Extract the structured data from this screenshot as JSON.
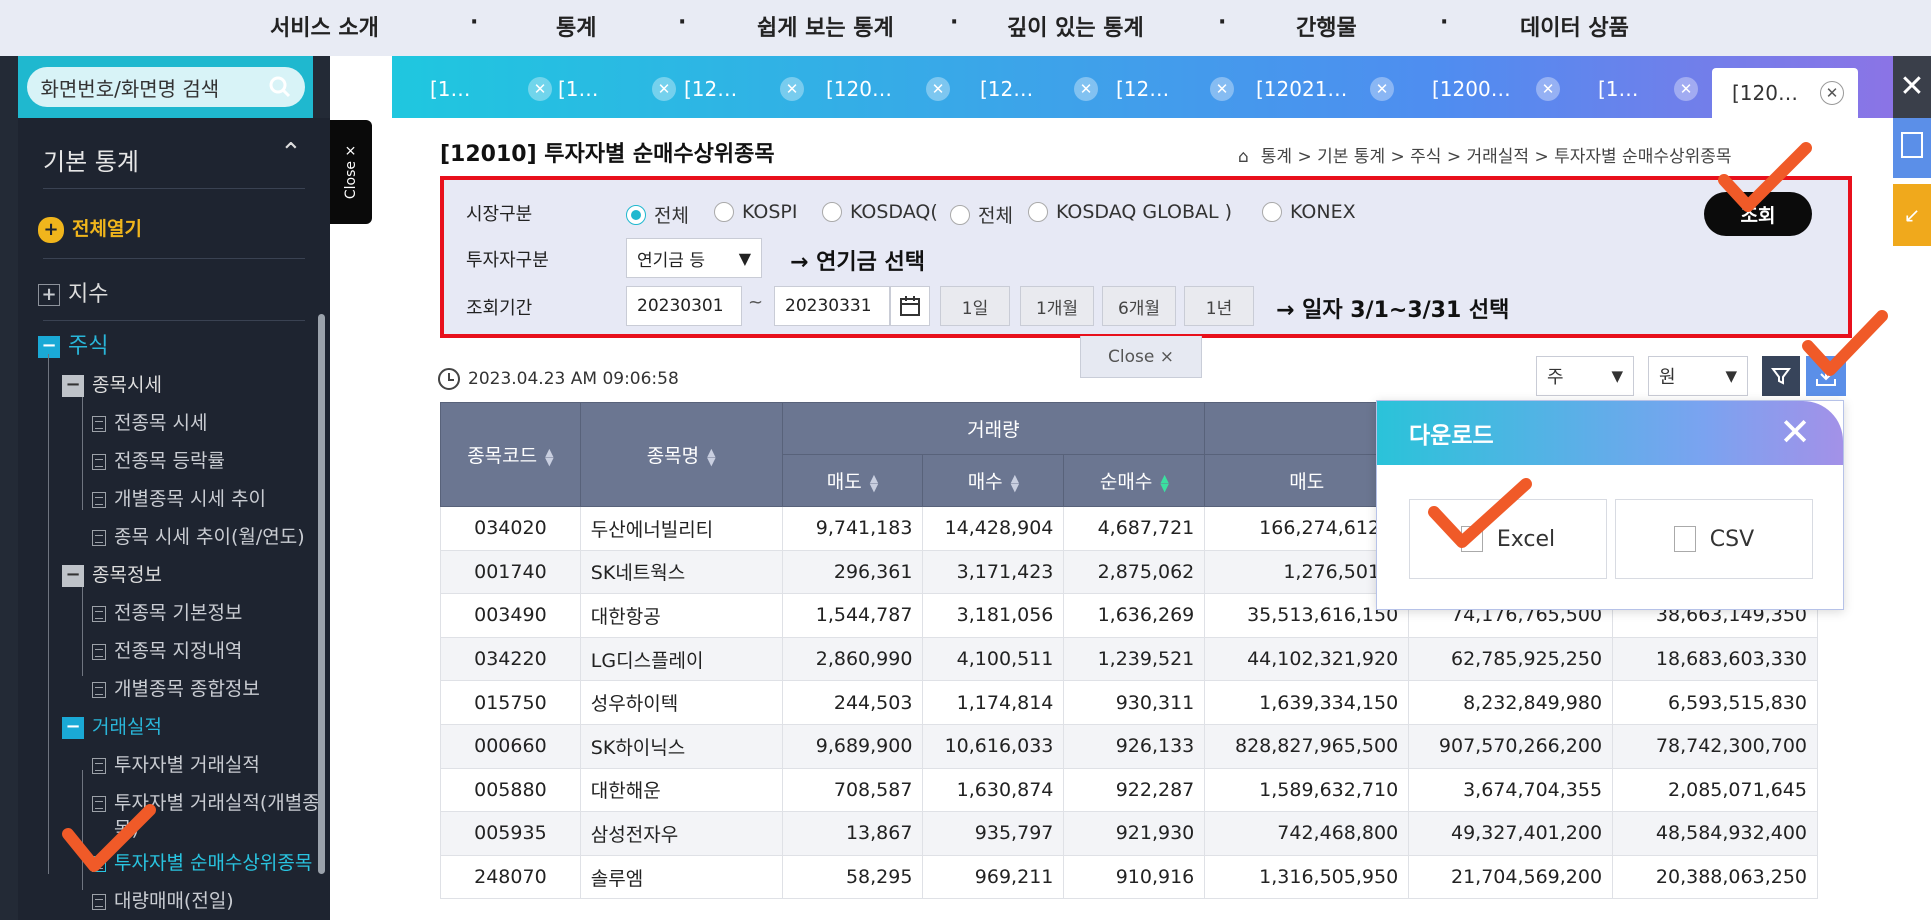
{
  "topnav": {
    "items": [
      "서비스 소개",
      "통계",
      "쉽게 보는 통계",
      "깊이 있는 통계",
      "간행물",
      "데이터 상품"
    ],
    "separator": "·"
  },
  "sidebar": {
    "search_placeholder": "화면번호/화면명 검색",
    "section_title": "기본 통계",
    "expand_all": "전체열기",
    "items": {
      "index": "지수",
      "stock": "주식",
      "price_group": "종목시세",
      "price_all": "전종목 시세",
      "price_change": "전종목 등락률",
      "price_trend": "개별종목 시세 추이",
      "price_trend_monthly": "종목 시세 추이(월/연도)",
      "info_group": "종목정보",
      "info_basic": "전종목 기본정보",
      "info_designation": "전종목 지정내역",
      "info_summary": "개별종목 종합정보",
      "trade_group": "거래실적",
      "trade_investor": "투자자별 거래실적",
      "trade_investor_indiv": "투자자별 거래실적(개별종",
      "trade_investor_indiv2": "목)",
      "trade_net_top": "투자자별 순매수상위종목",
      "block_trade": "대량매매(전일)"
    },
    "close_label": "Close ×"
  },
  "tabs": [
    {
      "label": "[1…"
    },
    {
      "label": "[1…"
    },
    {
      "label": "[12…"
    },
    {
      "label": "[120…"
    },
    {
      "label": "[12…"
    },
    {
      "label": "[12…"
    },
    {
      "label": "[12021…"
    },
    {
      "label": "[1200…"
    },
    {
      "label": "[1…"
    },
    {
      "label": "[120…"
    }
  ],
  "page": {
    "title": "[12010] 투자자별 순매수상위종목",
    "breadcrumb": "통계  >  기본 통계  >  주식  >  거래실적  >  투자자별 순매수상위종목"
  },
  "filters": {
    "market_label": "시장구분",
    "market_options": [
      "전체",
      "KOSPI",
      "KOSDAQ(",
      "전체",
      "KOSDAQ GLOBAL )",
      "KONEX"
    ],
    "market_selected": 0,
    "investor_label": "투자자구분",
    "investor_value": "연기금 등",
    "investor_note": "→ 연기금 선택",
    "period_label": "조회기간",
    "date_from": "20230301",
    "date_sep": "~",
    "date_to": "20230331",
    "period_buttons": [
      "1일",
      "1개월",
      "6개월",
      "1년"
    ],
    "period_note": "→ 일자 3/1~3/31 선택",
    "search_button": "조회"
  },
  "close_chip": "Close  ×",
  "timestamp": "2023.04.23 AM 09:06:58",
  "unit_selects": {
    "share_unit": "주",
    "money_unit": "원"
  },
  "table": {
    "headers": {
      "code": "종목코드",
      "name": "종목명",
      "volume": "거래량",
      "sell": "매도",
      "buy": "매수",
      "net": "순매수",
      "sell2": "매도"
    },
    "rows": [
      [
        "034020",
        "두산에너빌리티",
        "9,741,183",
        "14,428,904",
        "4,687,721",
        "166,274,612,5",
        "",
        ""
      ],
      [
        "001740",
        "SK네트웍스",
        "296,361",
        "3,171,423",
        "2,875,062",
        "1,276,501,5",
        "",
        ""
      ],
      [
        "003490",
        "대한항공",
        "1,544,787",
        "3,181,056",
        "1,636,269",
        "35,513,616,150",
        "74,176,765,500",
        "38,663,149,350"
      ],
      [
        "034220",
        "LG디스플레이",
        "2,860,990",
        "4,100,511",
        "1,239,521",
        "44,102,321,920",
        "62,785,925,250",
        "18,683,603,330"
      ],
      [
        "015750",
        "성우하이텍",
        "244,503",
        "1,174,814",
        "930,311",
        "1,639,334,150",
        "8,232,849,980",
        "6,593,515,830"
      ],
      [
        "000660",
        "SK하이닉스",
        "9,689,900",
        "10,616,033",
        "926,133",
        "828,827,965,500",
        "907,570,266,200",
        "78,742,300,700"
      ],
      [
        "005880",
        "대한해운",
        "708,587",
        "1,630,874",
        "922,287",
        "1,589,632,710",
        "3,674,704,355",
        "2,085,071,645"
      ],
      [
        "005935",
        "삼성전자우",
        "13,867",
        "935,797",
        "921,930",
        "742,468,800",
        "49,327,401,200",
        "48,584,932,400"
      ],
      [
        "248070",
        "솔루엠",
        "58,295",
        "969,211",
        "910,916",
        "1,316,505,950",
        "21,704,569,200",
        "20,388,063,250"
      ]
    ]
  },
  "download_popup": {
    "title": "다운로드",
    "excel": "Excel",
    "csv": "CSV"
  },
  "colors": {
    "accent": "#1fb8cf",
    "highlight_box": "#e8101c",
    "checkmark": "#f05a28",
    "header_bg": "#6b7691"
  }
}
